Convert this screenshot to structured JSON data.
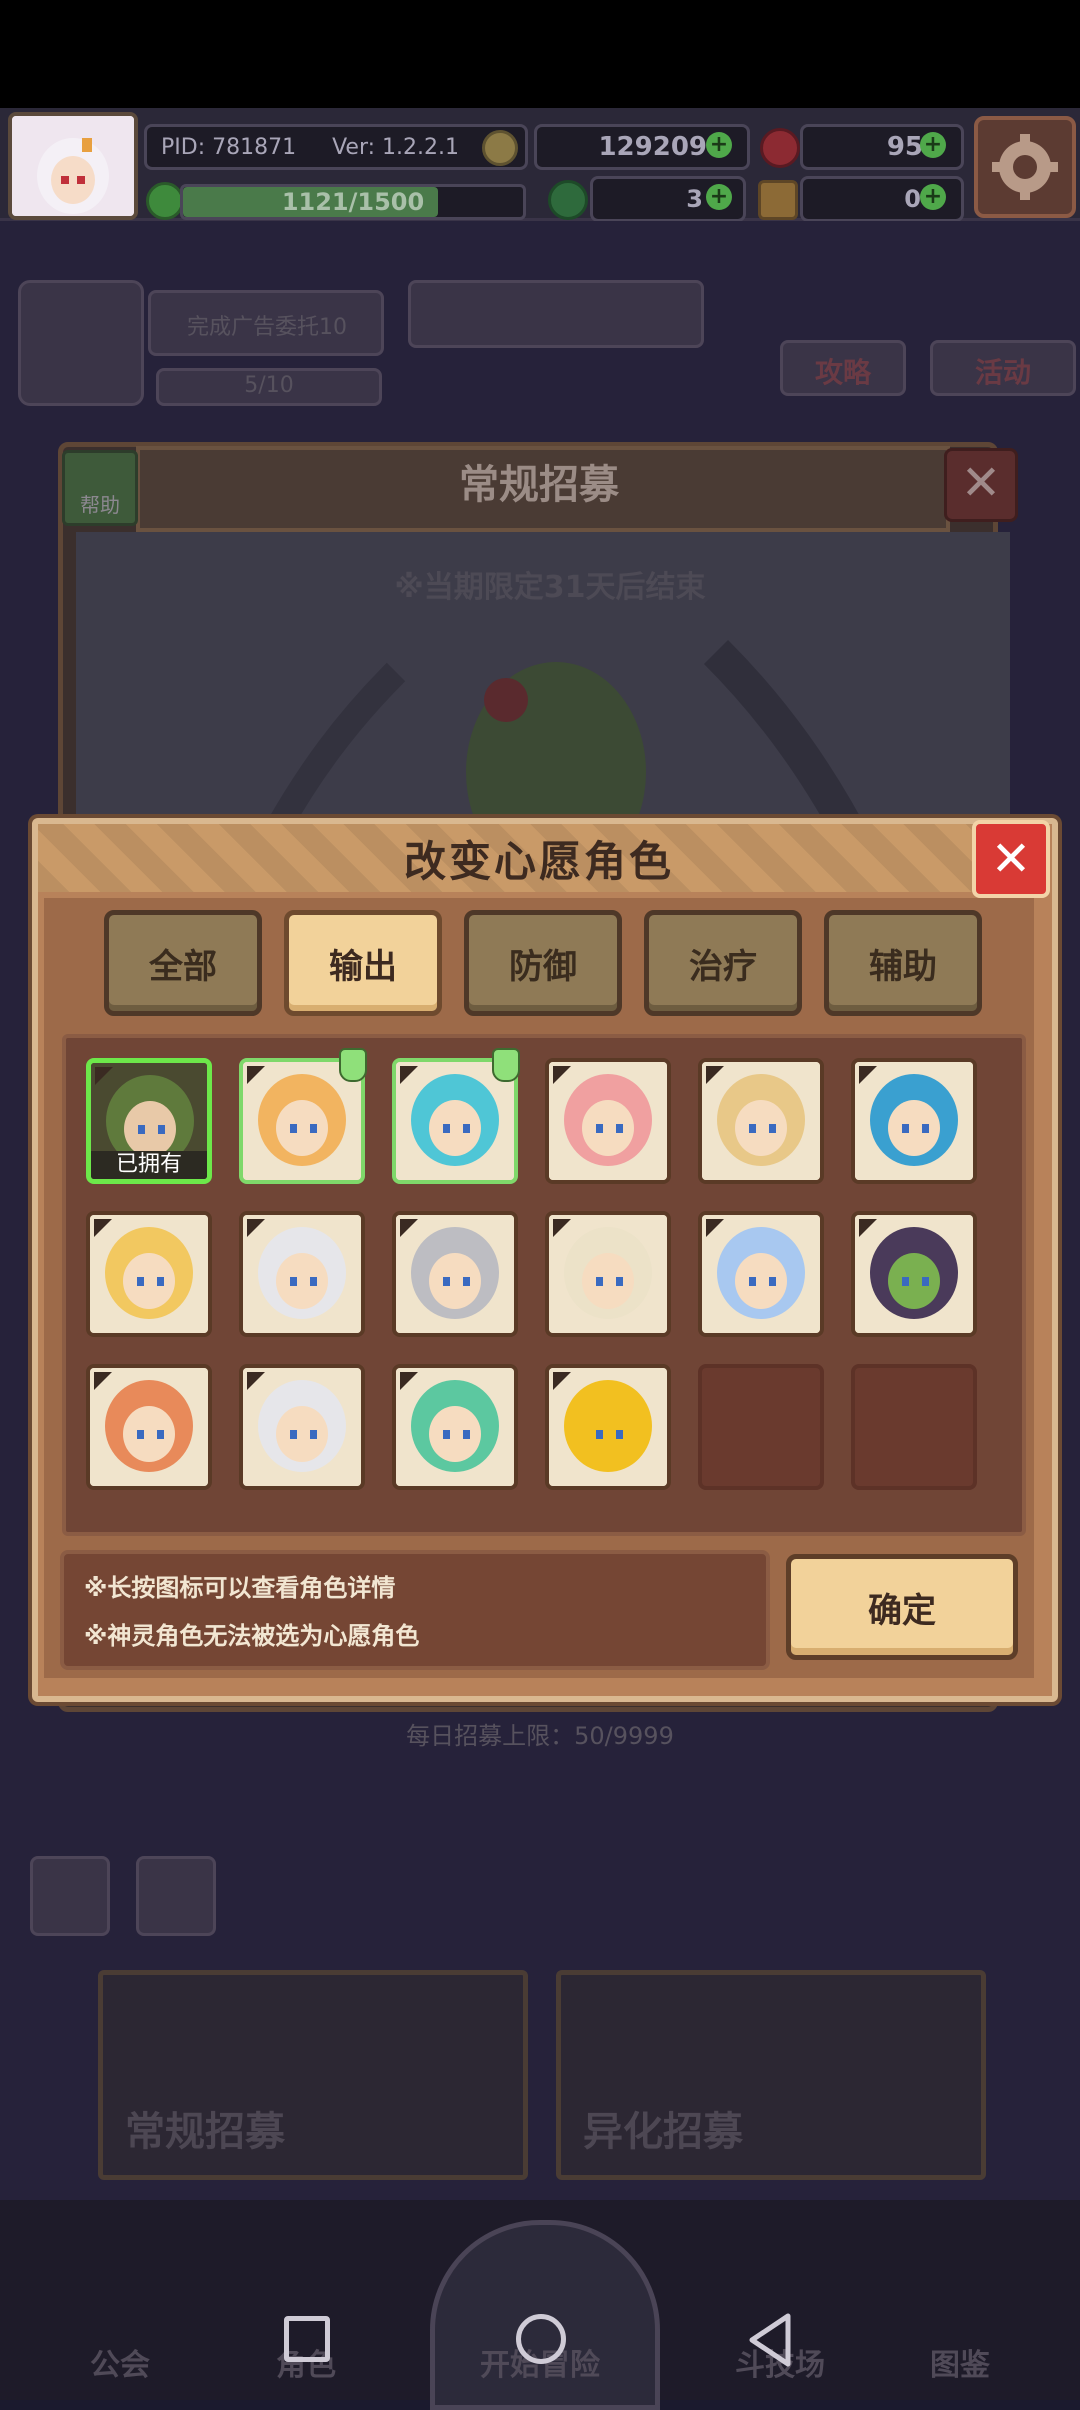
{
  "hud": {
    "pid": "PID: 781871",
    "version": "Ver: 1.2.2.1",
    "gold": "129209",
    "gems": "95",
    "stamina": "1121/1500",
    "stamina_fraction": 0.75,
    "clover": "3",
    "item": "0",
    "colors": {
      "gold": "#c9a23a",
      "gem": "#c92c3a",
      "plus": "#4fa84a"
    }
  },
  "background": {
    "panel_title": "常规招募",
    "help_label": "帮助",
    "limited_notice": "※当期限定31天后结束",
    "daily_limit": "每日招募上限：50/9999",
    "strategy": "攻略",
    "activity": "活动",
    "task": "完成广告委托10",
    "task_progress": "5/10",
    "recruit_tabs": [
      "常规招募",
      "异化招募"
    ],
    "bottom_nav": [
      "公会",
      "角色",
      "开始冒险",
      "斗技场",
      "图鉴"
    ]
  },
  "modal": {
    "title": "改变心愿角色",
    "tabs": [
      "全部",
      "输出",
      "防御",
      "治疗",
      "辅助"
    ],
    "active_tab": "输出",
    "owned_label": "已拥有",
    "notes": [
      "※长按图标可以查看角色详情",
      "※神灵角色无法被选为心愿角色"
    ],
    "confirm": "确定",
    "characters": [
      {
        "hair": "#5f7a3c",
        "skin": "#e8c9a8",
        "state": "owned"
      },
      {
        "hair": "#f2b460",
        "skin": "#f6dcc0",
        "state": "wished"
      },
      {
        "hair": "#4fc6d6",
        "skin": "#f6dcc0",
        "state": "wished"
      },
      {
        "hair": "#f0a0a0",
        "skin": "#f6dcc0",
        "state": "normal"
      },
      {
        "hair": "#e8c888",
        "skin": "#f6dcc0",
        "state": "normal"
      },
      {
        "hair": "#3aa0d0",
        "skin": "#f6dcc0",
        "state": "normal"
      },
      {
        "hair": "#f2c860",
        "skin": "#f6dcc0",
        "state": "normal"
      },
      {
        "hair": "#e6e6ea",
        "skin": "#f6dcc0",
        "state": "normal"
      },
      {
        "hair": "#bdbdc2",
        "skin": "#f6dcc0",
        "state": "normal"
      },
      {
        "hair": "#ece2c8",
        "skin": "#f6dcc0",
        "state": "normal"
      },
      {
        "hair": "#a8c8f0",
        "skin": "#f6dcc0",
        "state": "normal"
      },
      {
        "hair": "#4a3a5a",
        "skin": "#7ab050",
        "state": "normal"
      },
      {
        "hair": "#e88a5a",
        "skin": "#f6dcc0",
        "state": "normal"
      },
      {
        "hair": "#e6e6ea",
        "skin": "#f6dcc0",
        "state": "normal"
      },
      {
        "hair": "#5cc8a0",
        "skin": "#f6dcc0",
        "state": "normal"
      },
      {
        "hair": "#f2c020",
        "skin": "#f2c020",
        "state": "normal"
      },
      {
        "state": "empty"
      },
      {
        "state": "empty"
      }
    ]
  }
}
